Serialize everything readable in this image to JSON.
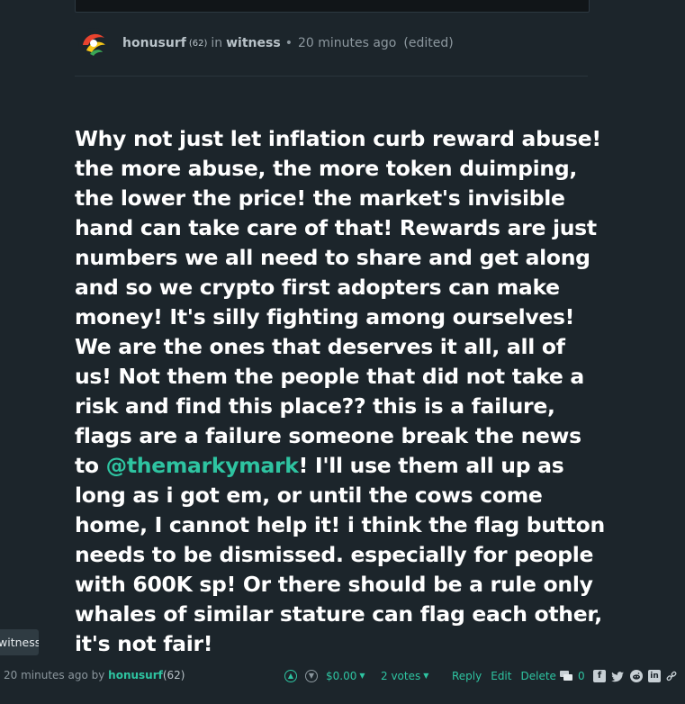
{
  "post": {
    "author": "honusurf",
    "author_rep": "(62)",
    "in_text": "in",
    "community": "witness",
    "separator": "•",
    "time": "20 minutes ago",
    "edited": "(edited)",
    "body_before_mention": "Why not just let inflation curb reward abuse! the more abuse, the more token duimping, the lower the price! the market's invisible hand can take care of that! Rewards are just numbers we all need to share and get along and so we crypto first adopters can make money! It's silly fighting among ourselves! We are the ones that deserves it all, all of us! Not them the people that did not take a risk and find this place?? this is a failure, flags are a failure someone break the news to ",
    "mention": "@themarkymark",
    "body_after_mention": "! I'll use them all up as long as i got em, or until the cows come home, I cannot help it! i think the flag button needs to be dismissed. especially for people with 600K sp! Or there should be a rule only whales of similar stature can flag each other, it's not fair!"
  },
  "tooltip": {
    "text": "witness"
  },
  "footer": {
    "time_by": "20 minutes ago by",
    "user": "honusurf",
    "user_rep": "(62)",
    "payout": "$0.00",
    "votes": "2 votes",
    "reply": "Reply",
    "edit": "Edit",
    "delete": "Delete",
    "comment_count": "0"
  },
  "icons": {
    "upvote": "chevron-up-icon",
    "downvote": "chevron-down-icon",
    "comments": "comments-icon",
    "facebook": "facebook-icon",
    "twitter": "twitter-icon",
    "reddit": "reddit-icon",
    "linkedin": "linkedin-icon",
    "permalink": "link-icon"
  },
  "colors": {
    "background": "#1c252b",
    "accent": "#2ec4a1",
    "muted": "#8c979e"
  }
}
